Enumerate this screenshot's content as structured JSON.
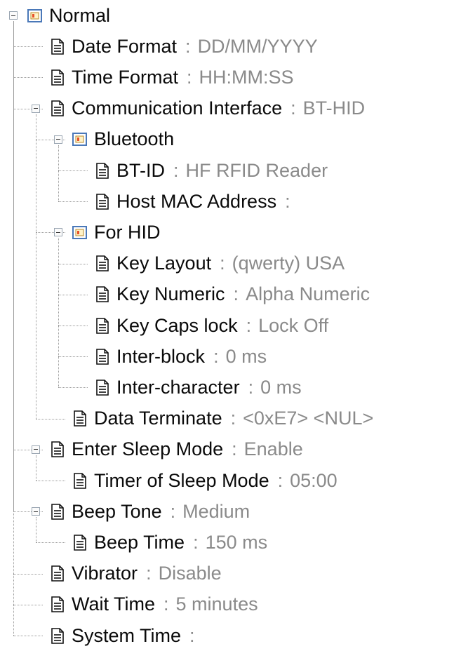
{
  "tree": [
    {
      "label": "Normal",
      "value": "",
      "icon": "folder-icon",
      "level": 0,
      "expanded": true
    },
    {
      "label": "Date Format",
      "value": "DD/MM/YYYY",
      "icon": "document-icon",
      "level": 1
    },
    {
      "label": "Time Format",
      "value": "HH:MM:SS",
      "icon": "document-icon",
      "level": 1
    },
    {
      "label": "Communication Interface",
      "value": "BT-HID",
      "icon": "document-icon",
      "level": 1,
      "expanded": true
    },
    {
      "label": "Bluetooth",
      "value": "",
      "icon": "folder-icon",
      "level": 2,
      "expanded": true
    },
    {
      "label": "BT-ID",
      "value": "HF RFID Reader",
      "icon": "document-icon",
      "level": 3
    },
    {
      "label": "Host MAC Address",
      "value": "",
      "icon": "document-icon",
      "level": 3
    },
    {
      "label": "For HID",
      "value": "",
      "icon": "folder-icon",
      "level": 2,
      "expanded": true
    },
    {
      "label": "Key Layout",
      "value": "(qwerty) USA",
      "icon": "document-icon",
      "level": 3
    },
    {
      "label": "Key Numeric",
      "value": "Alpha Numeric",
      "icon": "document-icon",
      "level": 3
    },
    {
      "label": "Key Caps lock",
      "value": "Lock Off",
      "icon": "document-icon",
      "level": 3
    },
    {
      "label": "Inter-block",
      "value": "0 ms",
      "icon": "document-icon",
      "level": 3
    },
    {
      "label": "Inter-character",
      "value": "0 ms",
      "icon": "document-icon",
      "level": 3
    },
    {
      "label": "Data Terminate",
      "value": "<0xE7> <NUL>",
      "icon": "document-icon",
      "level": 2
    },
    {
      "label": "Enter Sleep Mode",
      "value": "Enable",
      "icon": "document-icon",
      "level": 1,
      "expanded": true
    },
    {
      "label": "Timer of Sleep Mode",
      "value": "05:00",
      "icon": "document-icon",
      "level": 2
    },
    {
      "label": "Beep Tone",
      "value": "Medium",
      "icon": "document-icon",
      "level": 1,
      "expanded": true
    },
    {
      "label": "Beep Time",
      "value": "150 ms",
      "icon": "document-icon",
      "level": 2
    },
    {
      "label": "Vibrator",
      "value": "Disable",
      "icon": "document-icon",
      "level": 1
    },
    {
      "label": "Wait Time",
      "value": "5 minutes",
      "icon": "document-icon",
      "level": 1
    },
    {
      "label": "System Time",
      "value": "",
      "icon": "document-icon",
      "level": 1
    }
  ],
  "separator": ":",
  "colors": {
    "label": "#0a0a0a",
    "value": "#8a8a8a",
    "folder_accent": "#e8502a",
    "folder_border": "#4a78b8"
  }
}
